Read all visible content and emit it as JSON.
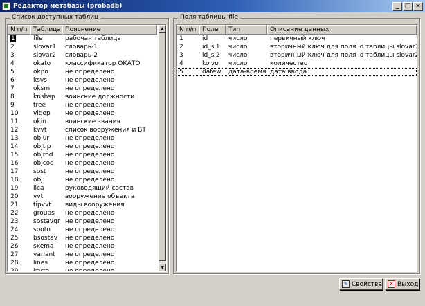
{
  "window": {
    "title": "Редактор метабазы (probadb)",
    "buttons": {
      "minimize": "_",
      "maximize": "□",
      "close": "×"
    }
  },
  "left_panel": {
    "title": "Список доступных таблиц",
    "columns": [
      "N п/п",
      "Таблица",
      "Пояснение"
    ],
    "rows": [
      [
        "1",
        "file",
        "рабочая таблица"
      ],
      [
        "2",
        "slovar1",
        "словарь-1"
      ],
      [
        "3",
        "slovar2",
        "словарь-2"
      ],
      [
        "4",
        "okato",
        "классификатор ОКАТО"
      ],
      [
        "5",
        "okpo",
        "не определено"
      ],
      [
        "6",
        "ksvs",
        "не определено"
      ],
      [
        "7",
        "oksm",
        "не определено"
      ],
      [
        "8",
        "knshsp",
        "воинские должности"
      ],
      [
        "9",
        "tree",
        "не определено"
      ],
      [
        "10",
        "vidop",
        "не определено"
      ],
      [
        "11",
        "okin",
        "воинские звания"
      ],
      [
        "12",
        "kvvt",
        "список вооружения и ВТ"
      ],
      [
        "13",
        "objur",
        "не определено"
      ],
      [
        "14",
        "objtip",
        "не определено"
      ],
      [
        "15",
        "objrod",
        "не определено"
      ],
      [
        "16",
        "objcod",
        "не определено"
      ],
      [
        "17",
        "sost",
        "не определено"
      ],
      [
        "18",
        "obj",
        "не определено"
      ],
      [
        "19",
        "lica",
        "руководящий состав"
      ],
      [
        "20",
        "vvt",
        "вооружение объекта"
      ],
      [
        "21",
        "tipvvt",
        "виды вооружения"
      ],
      [
        "22",
        "groups",
        "не определено"
      ],
      [
        "23",
        "sostavgr",
        "не определено"
      ],
      [
        "24",
        "sootn",
        "не определено"
      ],
      [
        "25",
        "bsostav",
        "не определено"
      ],
      [
        "26",
        "sxema",
        "не определено"
      ],
      [
        "27",
        "variant",
        "не определено"
      ],
      [
        "28",
        "lines",
        "не определено"
      ],
      [
        "29",
        "karta",
        "не определено"
      ]
    ],
    "scroll": {
      "up": "▲",
      "down": "▼"
    }
  },
  "right_panel": {
    "title": "Поля таблицы file",
    "columns": [
      "N п/п",
      "Поле",
      "Тип",
      "Описание данных"
    ],
    "rows": [
      [
        "1",
        "id",
        "число",
        "первичный ключ"
      ],
      [
        "2",
        "id_sl1",
        "число",
        "вторичный ключ для поля id таблицы slovar1"
      ],
      [
        "3",
        "id_sl2",
        "число",
        "вторичный ключ для поля id таблицы slovar2"
      ],
      [
        "4",
        "kolvo",
        "число",
        "количество"
      ],
      [
        "5",
        "datew",
        "дата-время",
        "дата ввода"
      ]
    ]
  },
  "buttons": {
    "properties": "Свойства",
    "exit": "Выход"
  }
}
